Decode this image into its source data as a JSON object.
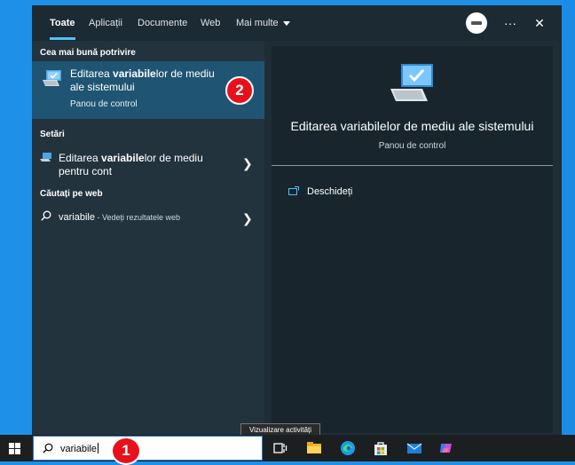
{
  "tabs": [
    "Toate",
    "Aplicații",
    "Documente",
    "Web",
    "Mai multe"
  ],
  "window_controls": {
    "more": "···",
    "close": "✕"
  },
  "best_match": {
    "section": "Cea mai bună potrivire",
    "title_pre": "Editarea ",
    "title_bold": "variabile",
    "title_post": "lor de mediu ale sistemului",
    "subtitle": "Panou de control",
    "badge": "2"
  },
  "settings": {
    "section": "Setări",
    "item_pre": "Editarea ",
    "item_bold": "variabile",
    "item_post": "lor de mediu pentru cont"
  },
  "web": {
    "section": "Căutați pe web",
    "query": "variabile",
    "suffix": " - Vedeți rezultatele web"
  },
  "detail": {
    "title": "Editarea variabilelor de mediu ale sistemului",
    "subtitle": "Panou de control",
    "open_label": "Deschideți"
  },
  "tooltip": "Vizualizare activități",
  "taskbar": {
    "search_value": "variabile",
    "badge": "1",
    "icons": [
      "start-icon",
      "task-view-icon",
      "file-explorer-icon",
      "edge-icon",
      "store-icon",
      "mail-icon",
      "copilot-icon"
    ]
  },
  "colors": {
    "desktop": "#1e90e8",
    "selected_result": "#1f5573",
    "accent": "#4cc2ff",
    "badge": "#e8111b"
  }
}
